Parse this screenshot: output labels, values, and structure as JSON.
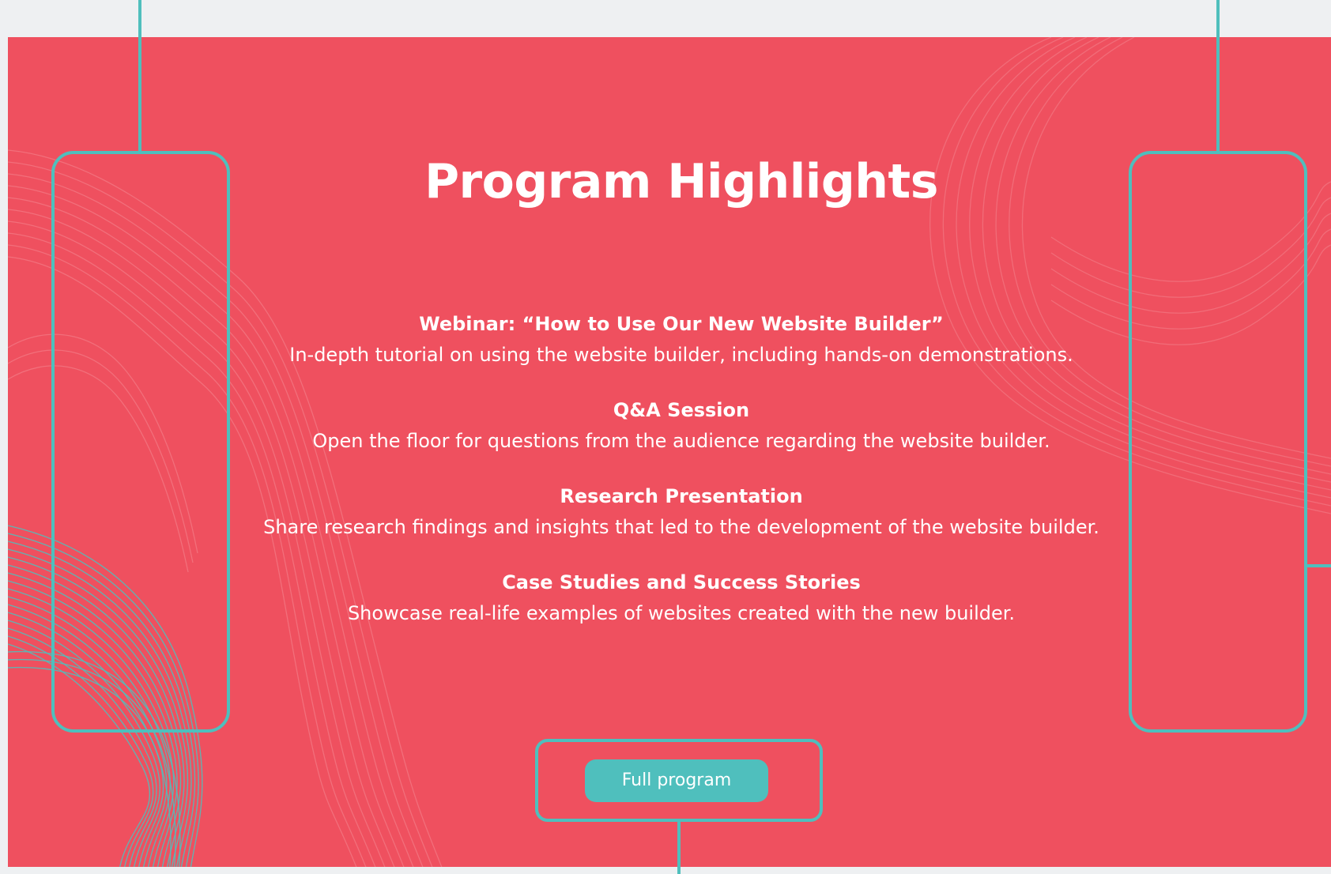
{
  "title": "Program Highlights",
  "items": [
    {
      "title": "Webinar: “How to Use Our New Website Builder”",
      "desc": "In-depth tutorial on using the website builder, including hands-on demonstrations."
    },
    {
      "title": "Q&A Session",
      "desc": "Open the floor for questions from the audience regarding the website builder."
    },
    {
      "title": "Research Presentation",
      "desc": "Share research findings and insights that led to the development of the website builder."
    },
    {
      "title": "Case Studies and Success Stories",
      "desc": "Showcase real-life examples of websites created with the new builder."
    }
  ],
  "cta": {
    "label": "Full program"
  },
  "colors": {
    "background": "#ef505f",
    "accent": "#4fbfbd",
    "page": "#eef0f2",
    "text": "#ffffff"
  }
}
